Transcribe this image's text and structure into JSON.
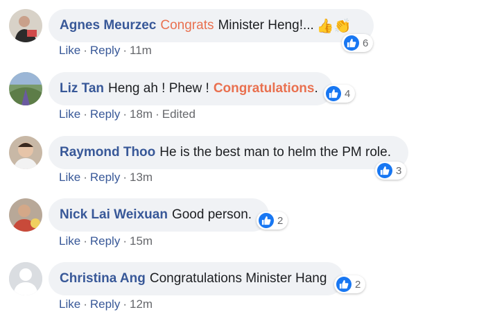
{
  "comments": [
    {
      "author": "Agnes Meurzec",
      "highlight": "Congrats",
      "text": "Minister Heng!...",
      "emoji": "👍👏",
      "like_label": "Like",
      "reply_label": "Reply",
      "time": "11m",
      "reactions": "6"
    },
    {
      "author": "Liz Tan",
      "text": "Heng ah ! Phew !",
      "highlight": "Congratulations",
      "tail": ".",
      "like_label": "Like",
      "reply_label": "Reply",
      "time": "18m",
      "edited": "Edited",
      "reactions": "4"
    },
    {
      "author": "Raymond Thoo",
      "text": "He is the best man to helm the PM role.",
      "like_label": "Like",
      "reply_label": "Reply",
      "time": "13m",
      "reactions": "3"
    },
    {
      "author": "Nick Lai Weixuan",
      "text": "Good person.",
      "like_label": "Like",
      "reply_label": "Reply",
      "time": "15m",
      "reactions": "2"
    },
    {
      "author": "Christina Ang",
      "text": "Congratulations Minister Hang",
      "like_label": "Like",
      "reply_label": "Reply",
      "time": "12m",
      "reactions": "2"
    }
  ],
  "separator": "·",
  "icons": {
    "reaction": "like-icon",
    "avatar_default": "default-avatar-icon"
  },
  "colors": {
    "author": "#385898",
    "highlight": "#e9704f",
    "like_blue": "#1877f2",
    "bubble": "#f0f2f5"
  }
}
